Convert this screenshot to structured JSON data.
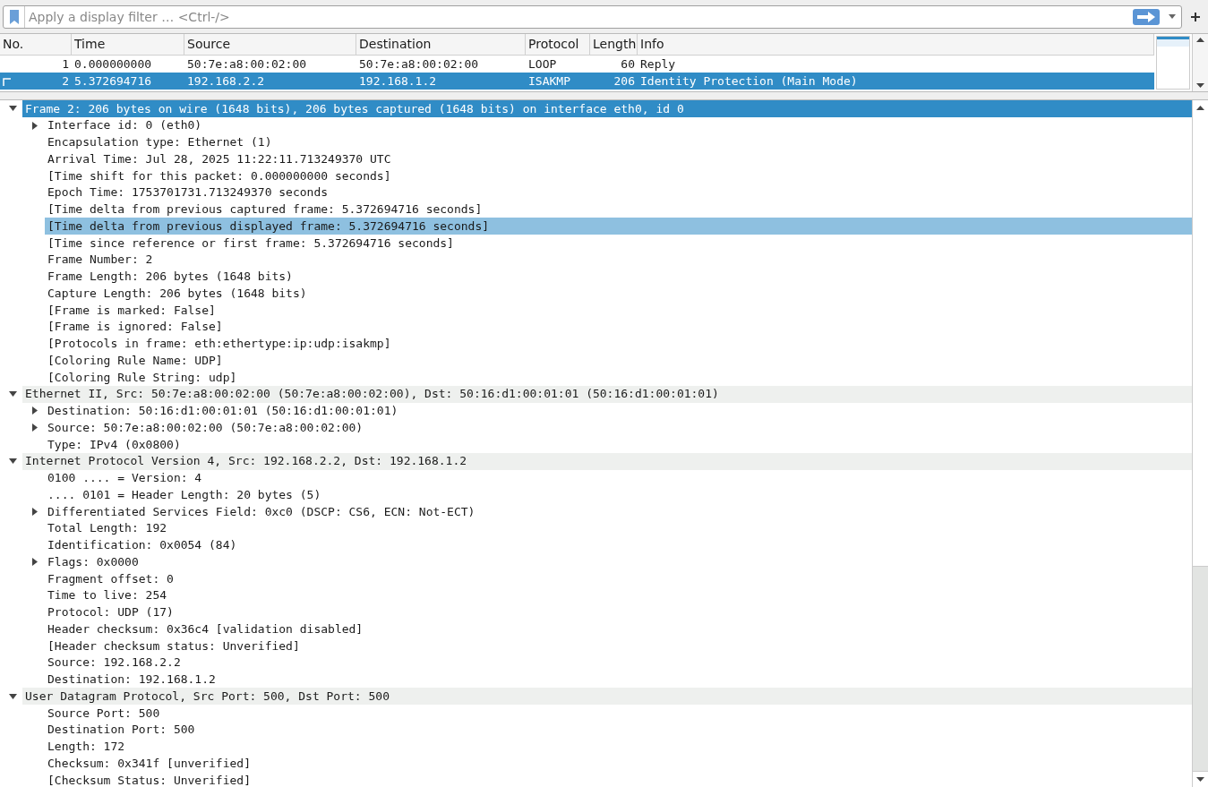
{
  "filter": {
    "placeholder": "Apply a display filter … <Ctrl-/>"
  },
  "packet_list": {
    "columns": [
      "No.",
      "Time",
      "Source",
      "Destination",
      "Protocol",
      "Length",
      "Info"
    ],
    "rows": [
      {
        "selected": false,
        "related": false,
        "cells": [
          "1",
          "0.000000000",
          "50:7e:a8:00:02:00",
          "50:7e:a8:00:02:00",
          "LOOP",
          "60",
          "Reply"
        ]
      },
      {
        "selected": true,
        "related": true,
        "cells": [
          "2",
          "5.372694716",
          "192.168.2.2",
          "192.168.1.2",
          "ISAKMP",
          "206",
          "Identity Protection (Main Mode)"
        ]
      }
    ]
  },
  "details": [
    {
      "text": "Frame 2: 206 bytes on wire (1648 bits), 206 bytes captured (1648 bits) on interface eth0, id 0",
      "expanded": true,
      "selected": true,
      "children": [
        {
          "text": "Interface id: 0 (eth0)",
          "expanded": false
        },
        {
          "text": "Encapsulation type: Ethernet (1)"
        },
        {
          "text": "Arrival Time: Jul 28, 2025 11:22:11.713249370 UTC"
        },
        {
          "text": "[Time shift for this packet: 0.000000000 seconds]"
        },
        {
          "text": "Epoch Time: 1753701731.713249370 seconds"
        },
        {
          "text": "[Time delta from previous captured frame: 5.372694716 seconds]"
        },
        {
          "text": "[Time delta from previous displayed frame: 5.372694716 seconds]",
          "highlighted": true
        },
        {
          "text": "[Time since reference or first frame: 5.372694716 seconds]"
        },
        {
          "text": "Frame Number: 2"
        },
        {
          "text": "Frame Length: 206 bytes (1648 bits)"
        },
        {
          "text": "Capture Length: 206 bytes (1648 bits)"
        },
        {
          "text": "[Frame is marked: False]"
        },
        {
          "text": "[Frame is ignored: False]"
        },
        {
          "text": "[Protocols in frame: eth:ethertype:ip:udp:isakmp]"
        },
        {
          "text": "[Coloring Rule Name: UDP]"
        },
        {
          "text": "[Coloring Rule String: udp]"
        }
      ]
    },
    {
      "text": "Ethernet II, Src: 50:7e:a8:00:02:00 (50:7e:a8:00:02:00), Dst: 50:16:d1:00:01:01 (50:16:d1:00:01:01)",
      "expanded": true,
      "selected": false,
      "children": [
        {
          "text": "Destination: 50:16:d1:00:01:01 (50:16:d1:00:01:01)",
          "expanded": false
        },
        {
          "text": "Source: 50:7e:a8:00:02:00 (50:7e:a8:00:02:00)",
          "expanded": false
        },
        {
          "text": "Type: IPv4 (0x0800)"
        }
      ]
    },
    {
      "text": "Internet Protocol Version 4, Src: 192.168.2.2, Dst: 192.168.1.2",
      "expanded": true,
      "selected": false,
      "children": [
        {
          "text": "0100 .... = Version: 4"
        },
        {
          "text": ".... 0101 = Header Length: 20 bytes (5)"
        },
        {
          "text": "Differentiated Services Field: 0xc0 (DSCP: CS6, ECN: Not-ECT)",
          "expanded": false
        },
        {
          "text": "Total Length: 192"
        },
        {
          "text": "Identification: 0x0054 (84)"
        },
        {
          "text": "Flags: 0x0000",
          "expanded": false
        },
        {
          "text": "Fragment offset: 0"
        },
        {
          "text": "Time to live: 254"
        },
        {
          "text": "Protocol: UDP (17)"
        },
        {
          "text": "Header checksum: 0x36c4 [validation disabled]"
        },
        {
          "text": "[Header checksum status: Unverified]"
        },
        {
          "text": "Source: 192.168.2.2"
        },
        {
          "text": "Destination: 192.168.1.2"
        }
      ]
    },
    {
      "text": "User Datagram Protocol, Src Port: 500, Dst Port: 500",
      "expanded": true,
      "selected": false,
      "children": [
        {
          "text": "Source Port: 500"
        },
        {
          "text": "Destination Port: 500"
        },
        {
          "text": "Length: 172"
        },
        {
          "text": "Checksum: 0x341f [unverified]"
        },
        {
          "text": "[Checksum Status: Unverified]"
        }
      ]
    }
  ]
}
